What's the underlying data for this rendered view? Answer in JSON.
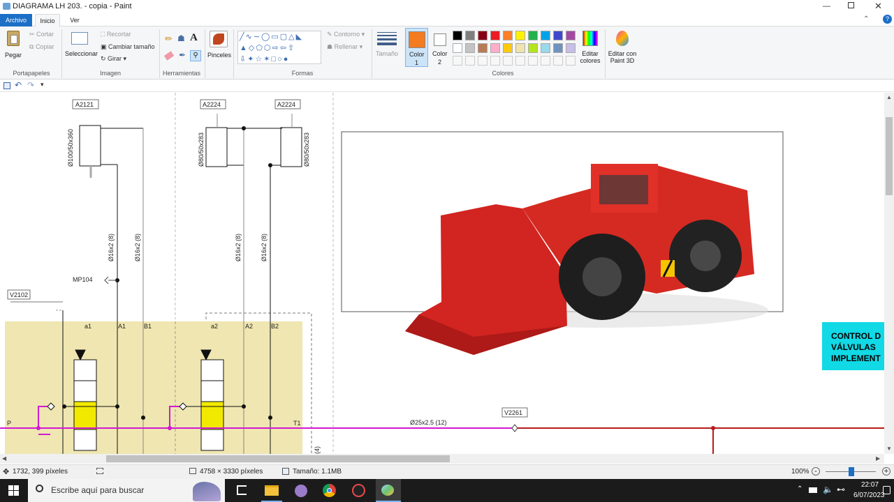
{
  "window": {
    "title": "DIAGRAMA LH 203. - copia - Paint",
    "minimize_icon": "minimize-icon",
    "maximize_icon": "maximize-icon",
    "close_icon": "close-icon"
  },
  "tabs": [
    {
      "label": "Archivo"
    },
    {
      "label": "Inicio"
    },
    {
      "label": "Ver"
    }
  ],
  "ribbon": {
    "clipboard": {
      "paste": "Pegar",
      "cut": "Cortar",
      "copy": "Copiar",
      "label": "Portapapeles"
    },
    "image": {
      "select": "Seleccionar",
      "crop": "Recortar",
      "resize": "Cambiar tamaño",
      "rotate": "Girar",
      "label": "Imagen"
    },
    "tools": {
      "label": "Herramientas"
    },
    "brushes": {
      "label": "Pinceles"
    },
    "shapes": {
      "outline": "Contorno",
      "fill": "Rellenar",
      "label": "Formas"
    },
    "size": {
      "label": "Tamaño"
    },
    "color1": {
      "label": "Color",
      "index": "1",
      "value": "#f47b20"
    },
    "color2": {
      "label": "Color",
      "index": "2",
      "value": "#ffffff"
    },
    "colors_label": "Colores",
    "edit_colors": {
      "line1": "Editar",
      "line2": "colores"
    },
    "paint3d": {
      "line1": "Editar con",
      "line2": "Paint 3D"
    },
    "palette_row1": [
      "#000000",
      "#7f7f7f",
      "#880015",
      "#ed1c24",
      "#ff7f27",
      "#fff200",
      "#22b14c",
      "#00a2e8",
      "#3f48cc",
      "#a349a4"
    ],
    "palette_row2": [
      "#ffffff",
      "#c3c3c3",
      "#b97a57",
      "#ffaec9",
      "#ffc90e",
      "#efe4b0",
      "#b5e61d",
      "#99d9ea",
      "#7092be",
      "#c8bfe7"
    ]
  },
  "diagram": {
    "labels": {
      "a2121": "A2121",
      "a2224_left": "A2224",
      "a2224_right": "A2224",
      "cyl1": "Ø100/50x360",
      "cyl2": "Ø80/50x283",
      "cyl3": "Ø80/50x283",
      "hose1": "Ø16x2 (8)",
      "hose2": "Ø16x2 (8)",
      "hose3": "Ø16x2 (8)",
      "hose4": "Ø16x2 (8)",
      "mp104": "MP104",
      "v2102": "V2102",
      "a1_low": "a1",
      "a1": "A1",
      "b1": "B1",
      "a2_low": "a2",
      "a2": "A2",
      "b2": "B2",
      "p": "P",
      "t1": "T1",
      "pipe": "Ø25x2.5 (12)",
      "v2261": "V2261",
      "four": "(4)"
    },
    "control_box": [
      "CONTROL D",
      "VÁLVULAS",
      "IMPLEMENT"
    ]
  },
  "status": {
    "cursor": "1732, 399 píxeles",
    "dimensions": "4758 × 3330 píxeles",
    "size": "Tamaño: 1.1MB",
    "zoom": "100%"
  },
  "taskbar": {
    "search_placeholder": "Escribe aquí para buscar",
    "time": "22:07",
    "date": "6/07/2023"
  }
}
